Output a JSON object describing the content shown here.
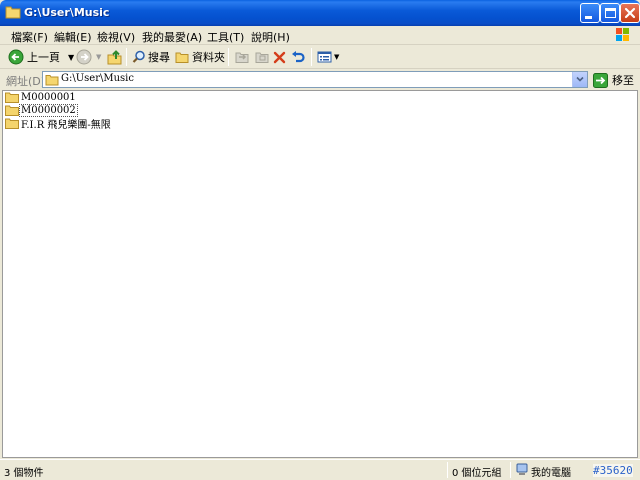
{
  "window": {
    "title": "G:\\User\\Music"
  },
  "menubar": {
    "items": [
      {
        "label": "檔案(F)"
      },
      {
        "label": "編輯(E)"
      },
      {
        "label": "檢視(V)"
      },
      {
        "label": "我的最愛(A)"
      },
      {
        "label": "工具(T)"
      },
      {
        "label": "說明(H)"
      }
    ]
  },
  "toolbar": {
    "back_label": "上一頁",
    "search_label": "搜尋",
    "folders_label": "資料夾"
  },
  "address": {
    "label": "網址(D)",
    "value": "G:\\User\\Music",
    "go_label": "移至"
  },
  "files": [
    {
      "name": "M0000001"
    },
    {
      "name": "M0000002"
    },
    {
      "name": "F.I.R 飛兒樂團-無限"
    }
  ],
  "status": {
    "objects": "3 個物件",
    "size": "0 個位元組",
    "location": "我的電腦"
  },
  "watermark": "#35620",
  "colors": {
    "titlebar": "#0a5ad8",
    "chrome": "#ece9d8",
    "folder": "#f4d46c"
  }
}
